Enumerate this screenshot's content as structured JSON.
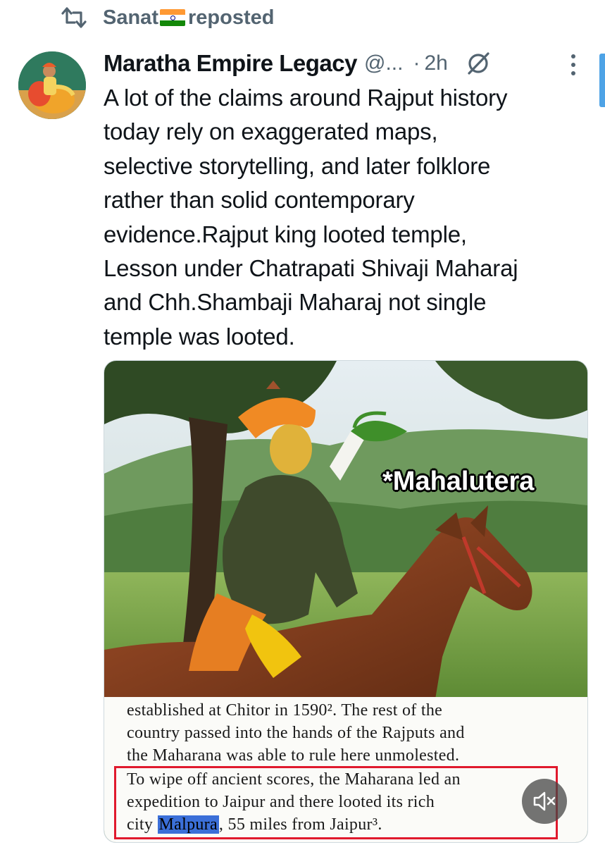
{
  "repost": {
    "icon": "repost-icon",
    "user": "Sanat",
    "flag": "india-flag-emoji",
    "label": "reposted"
  },
  "post": {
    "author_name": "Maratha Empire Legacy",
    "author_handle": "@...",
    "separator": "·",
    "time": "2h",
    "text_lines": [
      "A lot of the claims around Rajput history",
      "today rely on exaggerated maps,",
      "selective storytelling, and later folklore",
      "rather than solid contemporary",
      "evidence.Rajput king looted temple,",
      "Lesson under Chatrapati Shivaji Maharaj",
      "and Chh.Shambaji Maharaj not single",
      "temple was looted."
    ]
  },
  "media": {
    "caption": "*Mahalutera",
    "document_lines": [
      "established at Chitor in 1590². The rest of the",
      "country passed into the hands of the Rajputs and",
      "the Maharana was able to rule here unmolested.",
      "To wipe off ancient scores, the Maharana led an",
      "expedition to Jaipur and there looted its rich",
      "city",
      "Malpura",
      ", 55 miles from Jaipur³."
    ],
    "mute_icon": "volume-muted-icon"
  },
  "colors": {
    "secondary_text": "#536471",
    "highlight_box": "#e0192d",
    "text_highlight": "#3b6fd8"
  }
}
